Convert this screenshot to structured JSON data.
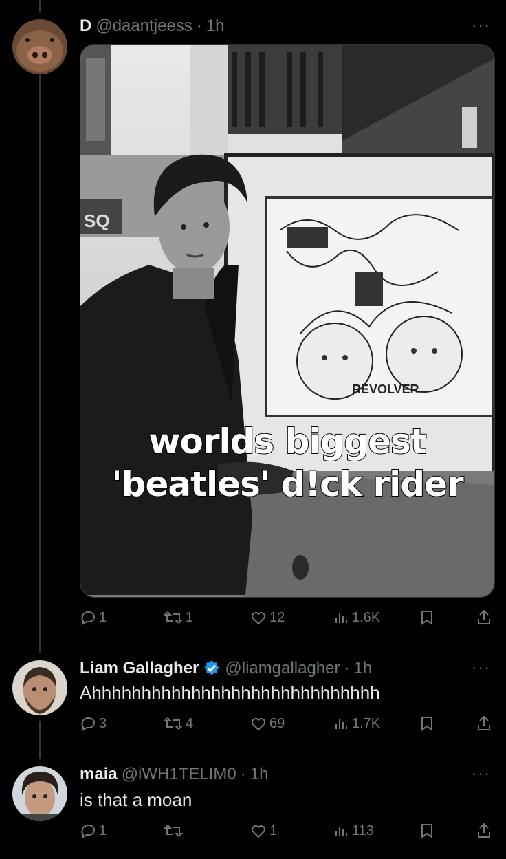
{
  "tweets": [
    {
      "name": "D",
      "handle": "@daantjeess",
      "time": "1h",
      "more": "···",
      "media": {
        "caption_line1": "worlds biggest",
        "caption_line2": "'beatles' d!ck rider",
        "poster_text": "REVOLVER",
        "sign_text": "SQ"
      },
      "replies": "1",
      "reposts": "1",
      "likes": "12",
      "views": "1.6K"
    },
    {
      "name": "Liam Gallagher",
      "handle": "@liamgallagher",
      "time": "1h",
      "more": "···",
      "text": "Ahhhhhhhhhhhhhhhhhhhhhhhhhhhhh",
      "verified": true,
      "replies": "3",
      "reposts": "4",
      "likes": "69",
      "views": "1.7K"
    },
    {
      "name": "maia",
      "handle": "@iWH1TELIM0",
      "time": "1h",
      "more": "···",
      "text": "is that a moan",
      "replies": "1",
      "reposts": "",
      "likes": "1",
      "views": "113"
    }
  ],
  "separator": "·",
  "colors": {
    "bg": "#000000",
    "text": "#e7e9ea",
    "muted": "#71767b",
    "verified": "#1d9bf0"
  },
  "icons": [
    "reply-icon",
    "repost-icon",
    "like-icon",
    "views-icon",
    "bookmark-icon",
    "share-icon",
    "more-icon",
    "verified-badge-icon"
  ]
}
